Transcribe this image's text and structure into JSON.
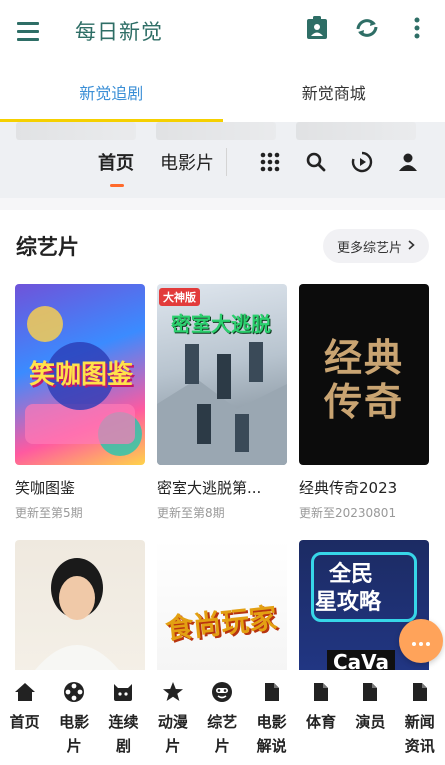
{
  "app": {
    "title": "每日新觉",
    "icons": [
      "menu-icon",
      "clipboard-user-icon",
      "sync-icon",
      "more-vert-icon"
    ]
  },
  "top_tabs": [
    {
      "label": "新觉追剧",
      "active": true
    },
    {
      "label": "新觉商城",
      "active": false
    }
  ],
  "subnav": {
    "tabs": [
      {
        "label": "首页",
        "active": true
      },
      {
        "label": "电影片",
        "active": false
      }
    ],
    "icons": [
      "grid-icon",
      "search-icon",
      "play-history-icon",
      "user-icon"
    ]
  },
  "section": {
    "title": "综艺片",
    "more_label": "更多综艺片"
  },
  "cards": [
    {
      "name": "笑咖图鉴",
      "sub": "更新至第5期"
    },
    {
      "name": "密室大逃脱第...",
      "sub": "更新至第8期"
    },
    {
      "name": "经典传奇2023",
      "sub": "更新至20230801"
    },
    {
      "name": "",
      "sub": ""
    },
    {
      "name": "",
      "sub": ""
    },
    {
      "name": "",
      "sub": ""
    }
  ],
  "posters": {
    "p1_text": "笑咖图鉴",
    "p2_text": "密室大逃脱",
    "p2_badge": "大神版",
    "p3_text": "经典传奇",
    "p5_text": "食尚玩家",
    "p6_text1": "全民",
    "p6_text2": "星攻略",
    "p6_text3": "CaVa"
  },
  "fab": {
    "label": "···"
  },
  "bottom_nav": [
    {
      "label": "首页",
      "icon": "home-icon"
    },
    {
      "label": "电影片",
      "icon": "film-reel-icon"
    },
    {
      "label": "连续剧",
      "icon": "tv-icon"
    },
    {
      "label": "动漫片",
      "icon": "star-icon"
    },
    {
      "label": "综艺片",
      "icon": "emoji-icon"
    },
    {
      "label": "电影解说",
      "icon": "file-icon"
    },
    {
      "label": "体育",
      "icon": "file-icon"
    },
    {
      "label": "演员",
      "icon": "file-icon"
    },
    {
      "label": "新闻资讯",
      "icon": "file-icon"
    }
  ],
  "colors": {
    "appbar_accent": "#2e6e66",
    "tab_active": "#3b8fd6",
    "tab_indicator": "#f5d000",
    "subnav_active_underline": "#ff6a2b",
    "fab": "#ffa35a"
  }
}
